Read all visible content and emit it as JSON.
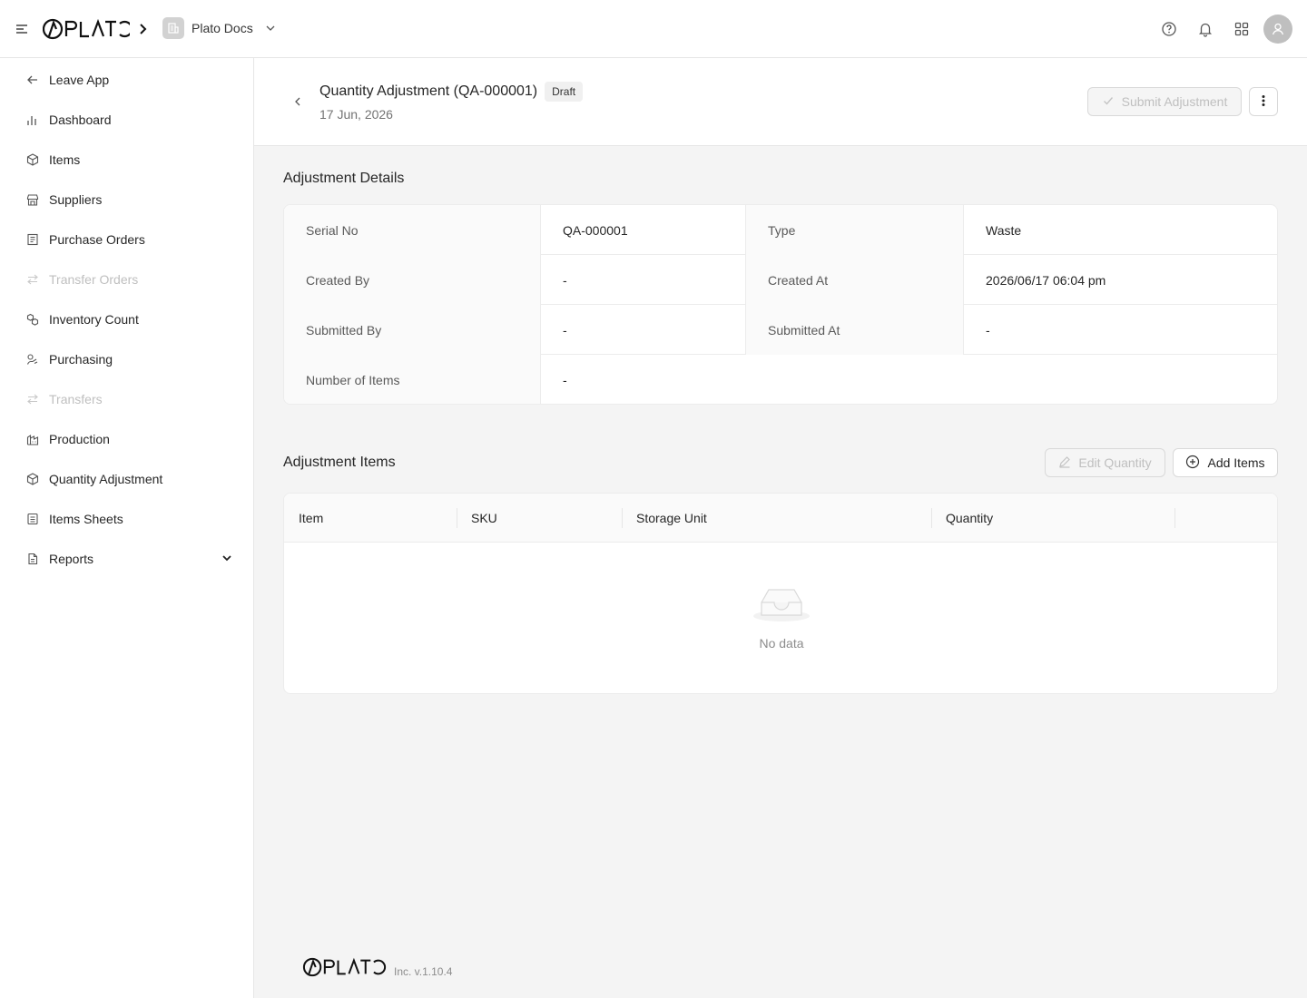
{
  "brand": {
    "logo_text": "PLATO"
  },
  "header": {
    "app_name": "Plato Docs",
    "icons": [
      "help-icon",
      "bell-icon",
      "apps-grid-icon",
      "user-avatar-icon"
    ]
  },
  "sidebar": {
    "items": [
      {
        "label": "Leave App",
        "icon": "arrow-left-icon",
        "disabled": false
      },
      {
        "label": "Dashboard",
        "icon": "bar-chart-icon",
        "disabled": false
      },
      {
        "label": "Items",
        "icon": "box-icon",
        "disabled": false
      },
      {
        "label": "Suppliers",
        "icon": "store-icon",
        "disabled": false
      },
      {
        "label": "Purchase Orders",
        "icon": "purchase-order-icon",
        "disabled": false
      },
      {
        "label": "Transfer Orders",
        "icon": "transfer-icon",
        "disabled": true
      },
      {
        "label": "Inventory Count",
        "icon": "boxes-icon",
        "disabled": false
      },
      {
        "label": "Purchasing",
        "icon": "purchasing-icon",
        "disabled": false
      },
      {
        "label": "Transfers",
        "icon": "transfer-icon",
        "disabled": true
      },
      {
        "label": "Production",
        "icon": "factory-icon",
        "disabled": false
      },
      {
        "label": "Quantity Adjustment",
        "icon": "box-icon",
        "disabled": false
      },
      {
        "label": "Items Sheets",
        "icon": "sheet-icon",
        "disabled": false
      },
      {
        "label": "Reports",
        "icon": "report-icon",
        "disabled": false
      }
    ]
  },
  "page": {
    "title": "Quantity Adjustment (QA-000001)",
    "status": "Draft",
    "date": "17 Jun, 2026",
    "submit_label": "Submit Adjustment"
  },
  "details": {
    "section_title": "Adjustment Details",
    "serial_no_label": "Serial No",
    "serial_no": "QA-000001",
    "type_label": "Type",
    "type": "Waste",
    "created_by_label": "Created By",
    "created_by": "-",
    "created_at_label": "Created At",
    "created_at": "2026/06/17 06:04 pm",
    "submitted_by_label": "Submitted By",
    "submitted_by": "-",
    "submitted_at_label": "Submitted At",
    "submitted_at": "-",
    "num_items_label": "Number of Items",
    "num_items": "-"
  },
  "items_section": {
    "title": "Adjustment Items",
    "edit_label": "Edit Quantity",
    "add_label": "Add Items",
    "columns": [
      "Item",
      "SKU",
      "Storage Unit",
      "Quantity"
    ],
    "empty_text": "No data"
  },
  "footer": {
    "version": "Inc. v.1.10.4"
  }
}
